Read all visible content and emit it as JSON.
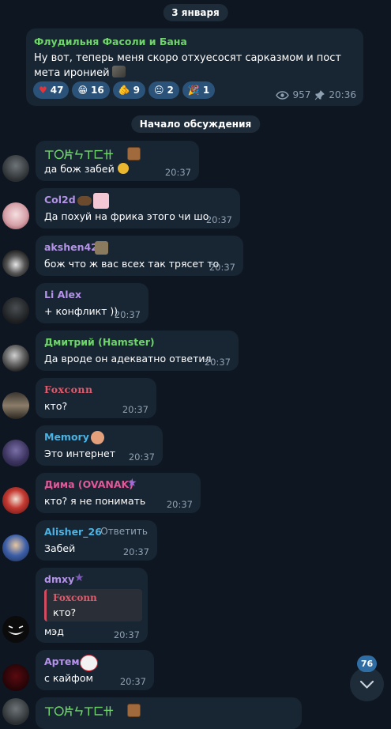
{
  "date_divider": "3 января",
  "channel_post": {
    "author": "Флудильня Фасоли и Бана",
    "text": "Ну вот, теперь меня скоро отхуесосят сарказмом и пост мета иронией",
    "reactions": [
      {
        "emoji": "♥",
        "count": "47"
      },
      {
        "emoji": "😁",
        "count": "16"
      },
      {
        "emoji": "🫵",
        "count": "9"
      },
      {
        "emoji": "😐",
        "count": "2"
      },
      {
        "emoji": "🎉",
        "count": "1"
      }
    ],
    "views": "957",
    "time": "20:36"
  },
  "discussion_divider": "Начало обсуждения",
  "messages": [
    {
      "sender": "ㄒ〇片ㄣㄒ匚卄",
      "text": "да бож забей",
      "time": "20:37",
      "color": "#6fd56a"
    },
    {
      "sender": "Col2d",
      "text": "Да похуй на фрика этого чи шо",
      "time": "20:37",
      "color": "#b493e8"
    },
    {
      "sender": "akshen42",
      "text": "бож что ж вас всех так трясет то",
      "time": "20:37",
      "color": "#b493e8"
    },
    {
      "sender": "Li Alex",
      "text": "+ конфликт ))",
      "time": "20:37",
      "color": "#b493e8"
    },
    {
      "sender": "Дмитрий (Hamster)",
      "text": "Да вроде он адекватно ответил",
      "time": "20:37",
      "color": "#6fd56a"
    },
    {
      "sender": "Foxconn",
      "text": "кто?",
      "time": "20:37",
      "color": "#e05a6b"
    },
    {
      "sender": "Memory",
      "text": "Это интернет",
      "time": "20:37",
      "color": "#4ab3e3"
    },
    {
      "sender": "Дима (OVANAK)",
      "text": "кто? я не понимать",
      "time": "20:37",
      "color": "#e05a9a"
    },
    {
      "sender": "Alisher_26",
      "text": "Забей",
      "time": "20:37",
      "color": "#4ab3e3",
      "reply_label": "Ответить"
    },
    {
      "sender": "dmxy",
      "quote_sender": "Foxconn",
      "quote_text": "кто?",
      "text": "мэд",
      "time": "20:37",
      "color": "#b493e8"
    },
    {
      "sender": "Артем",
      "text": "с кайфом",
      "time": "20:37",
      "color": "#b493e8"
    },
    {
      "sender": "ㄒ〇片ㄣㄒ匚卄",
      "text": "",
      "time": "",
      "color": "#6fd56a"
    }
  ],
  "unread_count": "76",
  "icons": {
    "views": "eye-icon",
    "pin": "pin-icon",
    "scroll_down": "chevron-down-icon"
  }
}
